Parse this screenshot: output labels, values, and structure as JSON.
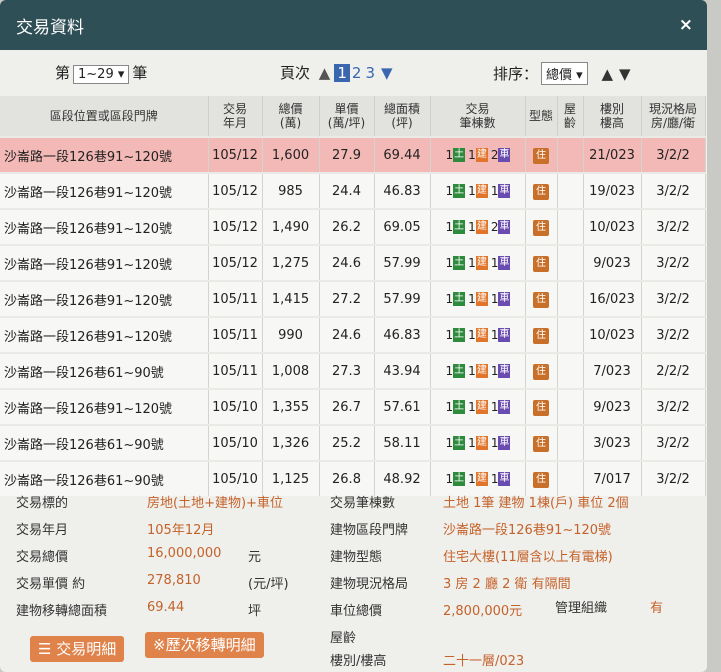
{
  "dialog": {
    "title": "交易資料",
    "close": "×"
  },
  "toolbar": {
    "pager_prefix": "第",
    "pager_value": "1~29",
    "pager_suffix": "筆",
    "page_label": "頁次",
    "pages": [
      "1",
      "2",
      "3"
    ],
    "current_page": "1",
    "sort_label": "排序：",
    "sort_value": "總價"
  },
  "table": {
    "headers": [
      "區段位置或區段門牌",
      "交易\n年月",
      "總價\n(萬)",
      "單價\n(萬/坪)",
      "總面積\n(坪)",
      "交易\n筆棟數",
      "型態",
      "屋齡",
      "樓別\n樓高",
      "現況格局\n房/廳/衛"
    ],
    "tag_land": "土",
    "tag_bldg": "建",
    "tag_car": "車",
    "use_tag": "住",
    "rows": [
      {
        "addr": "沙崙路一段126巷91~120號",
        "ym": "105/12",
        "total": "1,600",
        "unit": "27.9",
        "area": "69.44",
        "land": "1",
        "bldg": "1",
        "car": "2",
        "age": "",
        "floor": "21/023",
        "layout": "3/2/2",
        "selected": true
      },
      {
        "addr": "沙崙路一段126巷91~120號",
        "ym": "105/12",
        "total": "985",
        "unit": "24.4",
        "area": "46.83",
        "land": "1",
        "bldg": "1",
        "car": "1",
        "age": "",
        "floor": "19/023",
        "layout": "3/2/2"
      },
      {
        "addr": "沙崙路一段126巷91~120號",
        "ym": "105/12",
        "total": "1,490",
        "unit": "26.2",
        "area": "69.05",
        "land": "1",
        "bldg": "1",
        "car": "2",
        "age": "",
        "floor": "10/023",
        "layout": "3/2/2"
      },
      {
        "addr": "沙崙路一段126巷91~120號",
        "ym": "105/12",
        "total": "1,275",
        "unit": "24.6",
        "area": "57.99",
        "land": "1",
        "bldg": "1",
        "car": "1",
        "age": "",
        "floor": "9/023",
        "layout": "3/2/2"
      },
      {
        "addr": "沙崙路一段126巷91~120號",
        "ym": "105/11",
        "total": "1,415",
        "unit": "27.2",
        "area": "57.99",
        "land": "1",
        "bldg": "1",
        "car": "1",
        "age": "",
        "floor": "16/023",
        "layout": "3/2/2"
      },
      {
        "addr": "沙崙路一段126巷91~120號",
        "ym": "105/11",
        "total": "990",
        "unit": "24.6",
        "area": "46.83",
        "land": "1",
        "bldg": "1",
        "car": "1",
        "age": "",
        "floor": "10/023",
        "layout": "3/2/2"
      },
      {
        "addr": "沙崙路一段126巷61~90號",
        "ym": "105/11",
        "total": "1,008",
        "unit": "27.3",
        "area": "43.94",
        "land": "1",
        "bldg": "1",
        "car": "1",
        "age": "",
        "floor": "7/023",
        "layout": "2/2/2"
      },
      {
        "addr": "沙崙路一段126巷91~120號",
        "ym": "105/10",
        "total": "1,355",
        "unit": "26.7",
        "area": "57.61",
        "land": "1",
        "bldg": "1",
        "car": "1",
        "age": "",
        "floor": "9/023",
        "layout": "3/2/2"
      },
      {
        "addr": "沙崙路一段126巷61~90號",
        "ym": "105/10",
        "total": "1,326",
        "unit": "25.2",
        "area": "58.11",
        "land": "1",
        "bldg": "1",
        "car": "1",
        "age": "",
        "floor": "3/023",
        "layout": "3/2/2"
      },
      {
        "addr": "沙崙路一段126巷61~90號",
        "ym": "105/10",
        "total": "1,125",
        "unit": "26.8",
        "area": "48.92",
        "land": "1",
        "bldg": "1",
        "car": "1",
        "age": "",
        "floor": "7/017",
        "layout": "3/2/2"
      }
    ]
  },
  "details": {
    "target_label": "交易標的",
    "target_value": "房地(土地+建物)+車位",
    "ym_label": "交易年月",
    "ym_value": "105年12月",
    "total_label": "交易總價",
    "total_value": "16,000,000",
    "total_unit": "元",
    "unit_label": "交易單價 約",
    "unit_value": "278,810",
    "unit_unit": "(元/坪)",
    "area_label": "建物移轉總面積",
    "area_value": "69.44",
    "area_unit": "坪",
    "count_label": "交易筆棟數",
    "count_value": "土地 1筆 建物 1棟(戶) 車位 2個",
    "addr_label": "建物區段門牌",
    "addr_value": "沙崙路一段126巷91~120號",
    "type_label": "建物型態",
    "type_value": "住宅大樓(11層含以上有電梯)",
    "layout_label": "建物現況格局",
    "layout_value": "3 房 2 廳 2 衛 有隔間",
    "parking_label": "車位總價",
    "parking_value": "2,800,000元",
    "mgmt_label": "管理組織",
    "mgmt_value": "有",
    "age_label": "屋齡",
    "floor_label": "樓別/樓高",
    "floor_value": "二十一層/023",
    "btn_detail": "☰ 交易明細",
    "btn_history": "※歷次移轉明細"
  }
}
